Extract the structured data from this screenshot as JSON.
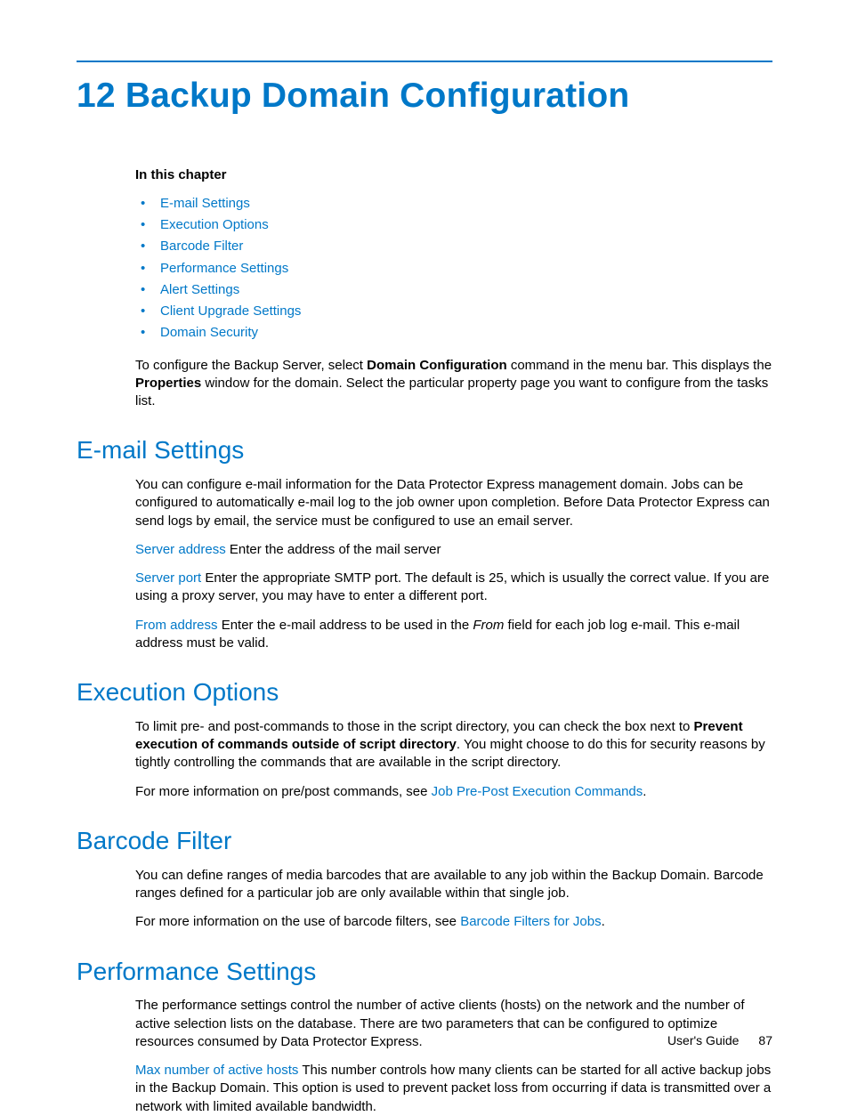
{
  "chapter": {
    "title": "12 Backup Domain Configuration"
  },
  "toc": {
    "heading": "In this chapter",
    "items": [
      "E-mail Settings",
      "Execution Options",
      "Barcode Filter",
      "Performance Settings",
      "Alert Settings",
      "Client Upgrade Settings",
      "Domain Security"
    ]
  },
  "intro": {
    "part1": "To configure the Backup Server, select ",
    "bold1": "Domain Configuration",
    "part2": " command in the menu bar.  This displays the ",
    "bold2": "Properties",
    "part3": " window for the domain.  Select the particular property page you want to configure from the tasks list."
  },
  "sections": {
    "email": {
      "heading": "E-mail Settings",
      "p1": "You can configure e-mail information for the Data Protector Express management domain. Jobs can be configured to automatically e-mail log to the job owner upon completion. Before Data Protector Express can send logs by email, the service must be configured to use an email server.",
      "server_address_label": "Server address",
      "server_address_text": "   Enter the address of the mail server",
      "server_port_label": "Server port",
      "server_port_text": "   Enter the appropriate SMTP port. The default is 25, which is usually the correct value. If you are using a proxy server, you may have to enter a different port.",
      "from_label": "From address",
      "from_text1": "   Enter the e-mail address to be used in the ",
      "from_italic": "From",
      "from_text2": " field for each job log e-mail. This e-mail address must be valid."
    },
    "exec": {
      "heading": "Execution Options",
      "p1a": "To limit pre- and post-commands to those in the script directory, you can check the box next to ",
      "p1bold": "Prevent execution of commands outside of script directory",
      "p1b": ".  You might choose to do this for security reasons by tightly controlling the commands that are available in the script directory.",
      "p2a": "For more information on pre/post commands, see ",
      "p2link": "Job Pre-Post Execution Commands",
      "p2b": "."
    },
    "barcode": {
      "heading": "Barcode Filter",
      "p1": "You can define ranges of media barcodes that are available to any job within the Backup Domain. Barcode ranges defined for a particular job are only available within that single job.",
      "p2a": "For more information on the use of barcode filters, see ",
      "p2link": "Barcode Filters for Jobs",
      "p2b": "."
    },
    "perf": {
      "heading": "Performance Settings",
      "p1": "The performance settings control the number of active clients (hosts) on the network and the number of active selection lists on the database. There are two parameters that can be configured to optimize resources consumed by Data Protector Express.",
      "max_label": "Max number of active hosts",
      "max_text": "   This number controls how many clients can be started for all active backup jobs in the Backup Domain. This option is used to prevent packet loss from occurring if data is transmitted over a network with limited available bandwidth."
    }
  },
  "footer": {
    "label": "User's Guide",
    "page": "87"
  }
}
